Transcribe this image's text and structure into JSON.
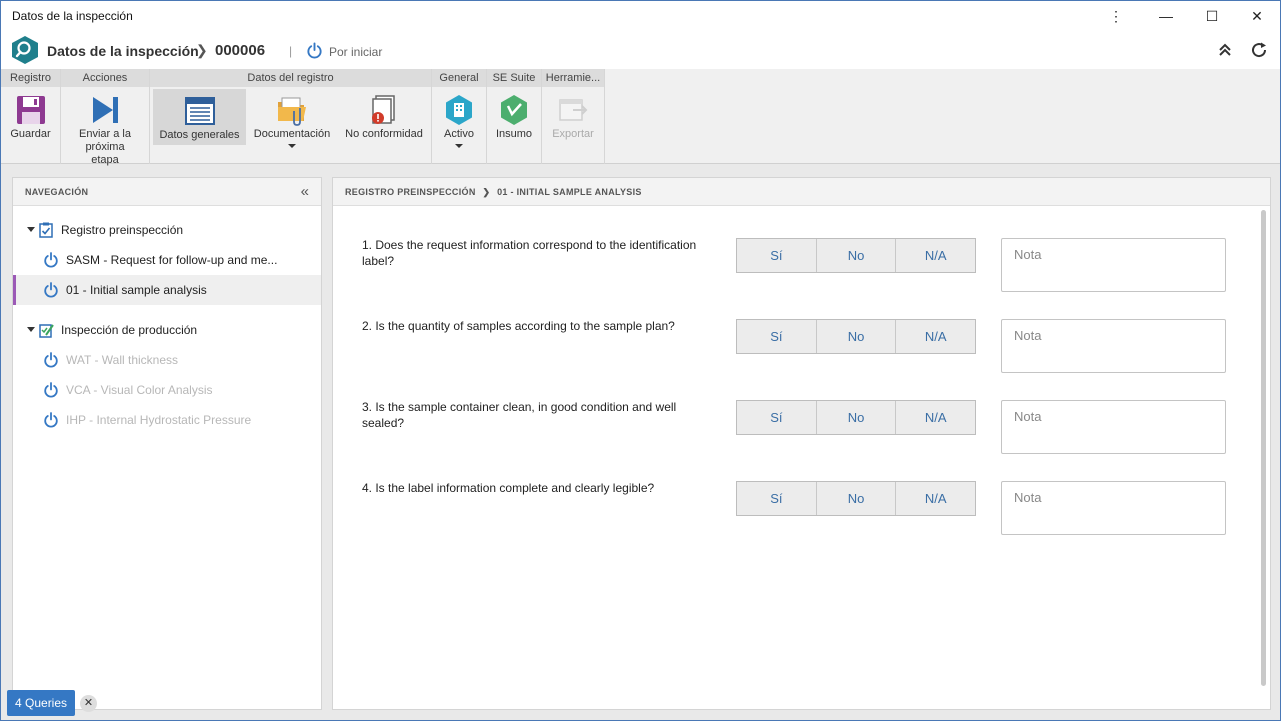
{
  "window": {
    "title": "Datos de la inspección",
    "kebab": "⋮",
    "minimize": "—",
    "maximize": "☐",
    "close": "✕"
  },
  "header": {
    "title": "Datos de la inspección",
    "separator": "❯",
    "record_id": "000006",
    "divider": "|",
    "status": "Por iniciar",
    "icons": [
      "collapse-up-icon",
      "refresh-icon"
    ]
  },
  "ribbon": {
    "groups": [
      {
        "title": "Registro",
        "buttons": [
          {
            "label": "Guardar",
            "icon": "save-icon"
          }
        ]
      },
      {
        "title": "Acciones",
        "buttons": [
          {
            "label": "Enviar a la próxima etapa",
            "icon": "next-stage-icon"
          }
        ]
      },
      {
        "title": "Datos del registro",
        "buttons": [
          {
            "label": "Datos generales",
            "icon": "general-data-icon",
            "active": true
          },
          {
            "label": "Documentación",
            "icon": "documentation-icon",
            "dropdown": true
          },
          {
            "label": "No conformidad",
            "icon": "nonconformity-icon"
          }
        ]
      },
      {
        "title": "General",
        "buttons": [
          {
            "label": "Activo",
            "icon": "asset-icon",
            "dropdown": true
          }
        ]
      },
      {
        "title": "SE Suite",
        "buttons": [
          {
            "label": "Insumo",
            "icon": "supply-icon"
          }
        ]
      },
      {
        "title": "Herramie...",
        "buttons": [
          {
            "label": "Exportar",
            "icon": "export-icon",
            "disabled": true
          }
        ]
      }
    ]
  },
  "navigation": {
    "title": "NAVEGACIÓN",
    "collapse": "«",
    "sections": [
      {
        "label": "Registro preinspección",
        "icon": "clipboard-check-icon",
        "items": [
          {
            "label": "SASM - Request for follow-up and me...",
            "enabled": true,
            "selected": false
          },
          {
            "label": "01 - Initial sample analysis",
            "enabled": true,
            "selected": true
          }
        ]
      },
      {
        "label": "Inspección de producción",
        "icon": "inspection-edit-icon",
        "items": [
          {
            "label": "WAT - Wall thickness",
            "enabled": false,
            "selected": false
          },
          {
            "label": "VCA - Visual Color Analysis",
            "enabled": false,
            "selected": false
          },
          {
            "label": "IHP - Internal Hydrostatic Pressure",
            "enabled": false,
            "selected": false
          }
        ]
      }
    ]
  },
  "main": {
    "breadcrumb": {
      "parent": "REGISTRO PREINSPECCIÓN",
      "separator": "❯",
      "current": "01 - INITIAL SAMPLE ANALYSIS"
    },
    "options": [
      "Sí",
      "No",
      "N/A"
    ],
    "note_placeholder": "Nota",
    "questions": [
      {
        "text": "1. Does the request information correspond to the identification label?"
      },
      {
        "text": "2. Is the quantity of samples according to the sample plan?"
      },
      {
        "text": "3. Is the sample container clean, in good condition and well sealed?"
      },
      {
        "text": "4. Is the label information complete and clearly legible?"
      }
    ]
  },
  "footer": {
    "queries": "4 Queries",
    "close": "✕"
  },
  "colors": {
    "accent": "#3578c4",
    "logo": "#1f7f8c",
    "selected_marker": "#9b59b6",
    "option_text": "#3a6ea5"
  }
}
